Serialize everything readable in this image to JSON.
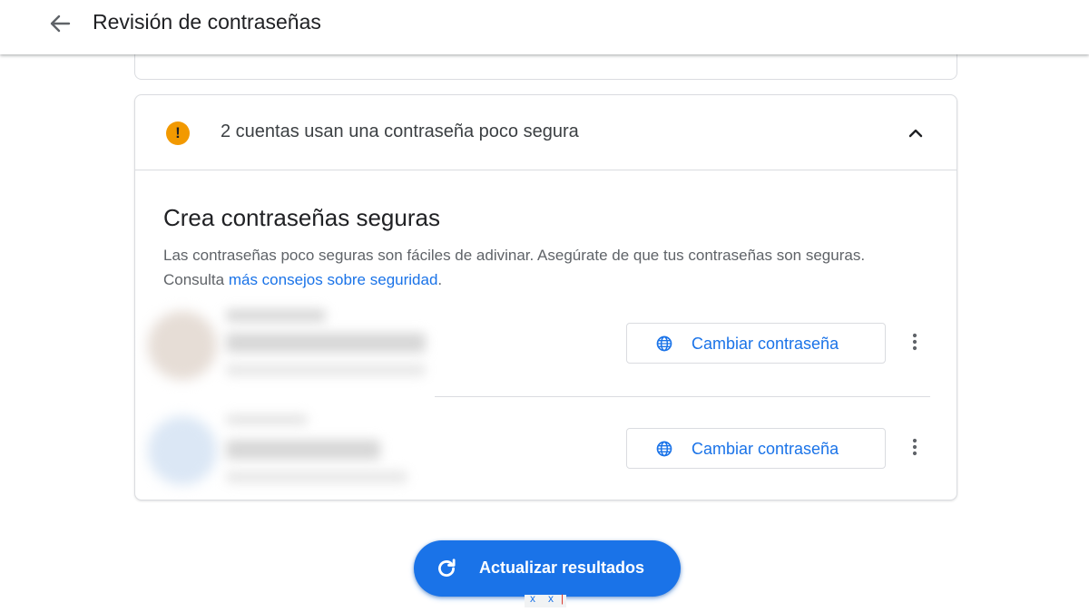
{
  "header": {
    "title": "Revisión de contraseñas",
    "back_icon": "arrow-back-icon"
  },
  "card": {
    "header_text": "2 cuentas usan una contraseña poco segura",
    "section_title": "Crea contraseñas seguras",
    "desc_text": "Las contraseñas poco seguras son fáciles de adivinar. Asegúrate de que tus contraseñas son seguras. Consulta ",
    "desc_link": "más consejos sobre seguridad",
    "desc_end": ".",
    "rows": [
      {
        "button_label": "Cambiar contraseña"
      },
      {
        "button_label": "Cambiar contraseña"
      }
    ]
  },
  "fab": {
    "label": "Actualizar resultados"
  },
  "colors": {
    "accent": "#1a73e8",
    "warning": "#f29900",
    "text": "#202124",
    "secondary_text": "#5f6368",
    "border": "#dadce0"
  }
}
